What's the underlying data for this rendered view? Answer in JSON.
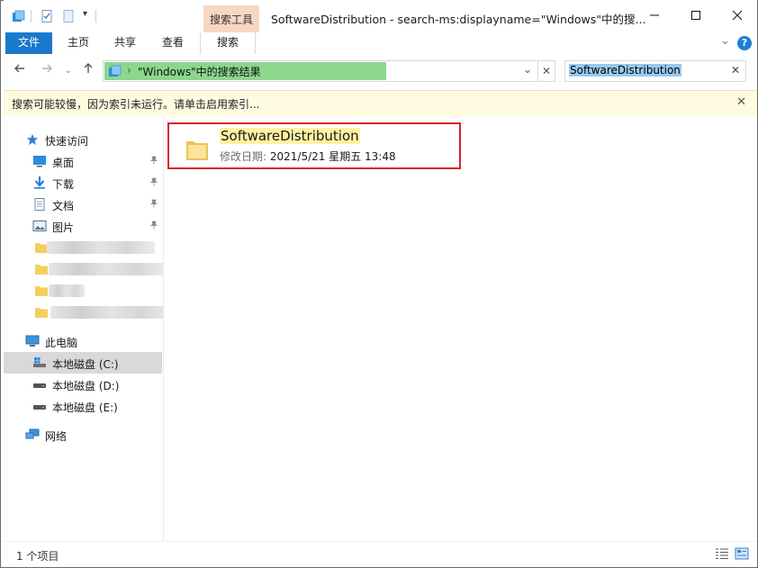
{
  "window": {
    "title": "SoftwareDistribution - search-ms:displayname=\"Windows\"中的搜...",
    "contextual_tab_group": "搜索工具",
    "controls": {
      "minimize": "—",
      "maximize": "☐",
      "close": "✕"
    }
  },
  "ribbon": {
    "tabs": [
      {
        "label": "文件"
      },
      {
        "label": "主页"
      },
      {
        "label": "共享"
      },
      {
        "label": "查看"
      },
      {
        "label": "搜索"
      }
    ],
    "collapse_glyph": "⌄",
    "help_glyph": "?"
  },
  "address": {
    "separator": "›",
    "path": "\"Windows\"中的搜索结果",
    "dropdown_glyph": "⌄",
    "clear_glyph": "✕"
  },
  "search": {
    "value": "SoftwareDistribution",
    "clear_glyph": "✕"
  },
  "infobar": {
    "message": "搜索可能较慢，因为索引未运行。请单击启用索引...",
    "close_glyph": "✕"
  },
  "nav": {
    "quick_access": "快速访问",
    "quick_items": [
      {
        "label": "桌面",
        "icon": "desktop-icon"
      },
      {
        "label": "下载",
        "icon": "download-icon"
      },
      {
        "label": "文档",
        "icon": "document-icon"
      },
      {
        "label": "图片",
        "icon": "picture-icon"
      }
    ],
    "this_pc": "此电脑",
    "drives": [
      {
        "label": "本地磁盘 (C:)"
      },
      {
        "label": "本地磁盘 (D:)"
      },
      {
        "label": "本地磁盘 (E:)"
      }
    ],
    "network": "网络",
    "pin_glyph": "📌"
  },
  "results": [
    {
      "name": "SoftwareDistribution",
      "meta_label": "修改日期:",
      "meta_value": "2021/5/21 星期五 13:48"
    }
  ],
  "status": {
    "count": "1 个项目"
  },
  "colors": {
    "file_tab": "#1979ca",
    "tool_header": "#f8d7c2",
    "address_highlight": "#8cd78e",
    "search_selection": "#99c9ef",
    "name_highlight": "#fff2a3",
    "result_border": "#d7242a",
    "infobar_bg": "#fffbe0"
  }
}
